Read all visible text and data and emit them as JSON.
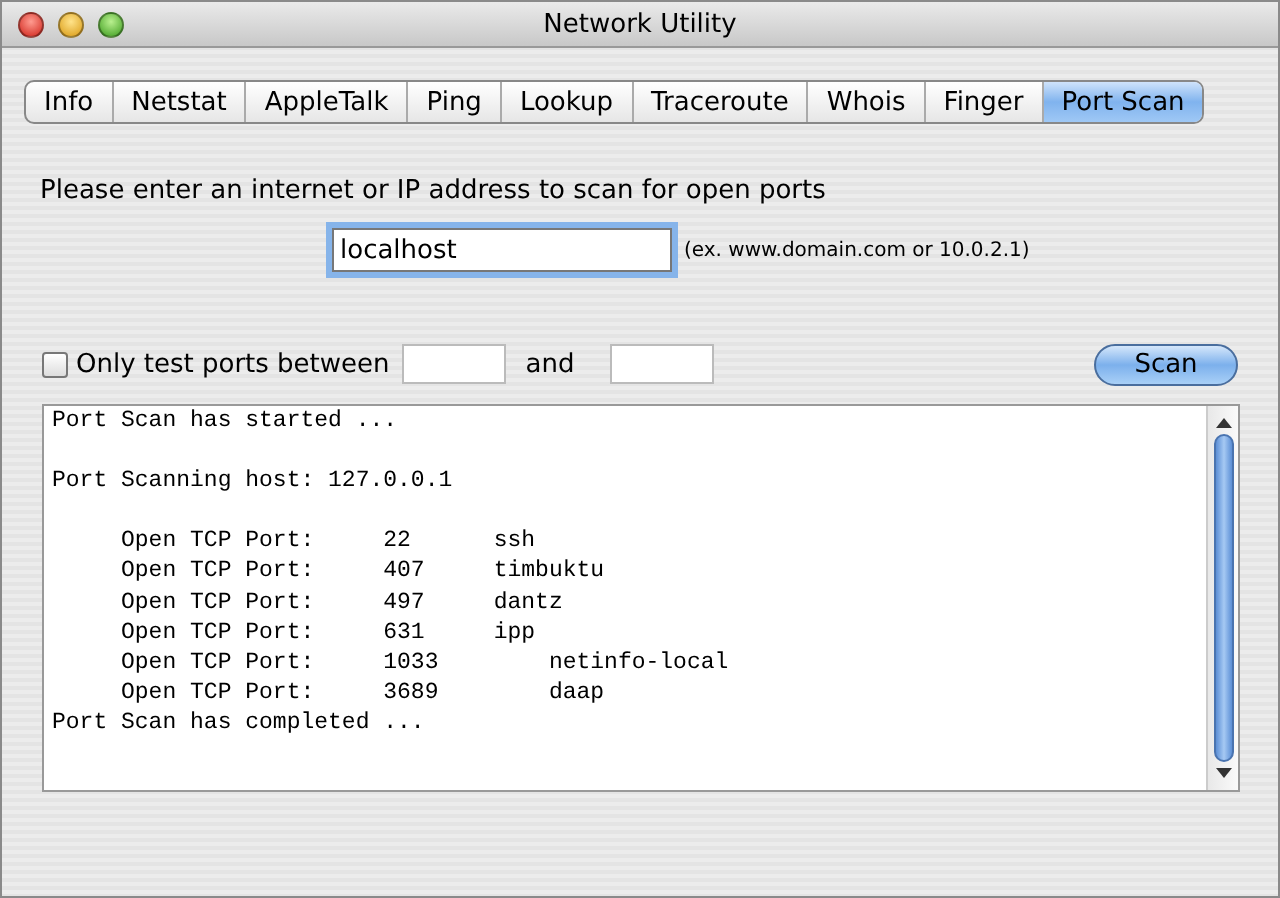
{
  "window": {
    "title": "Network Utility"
  },
  "tabs": [
    {
      "label": "Info",
      "selected": false
    },
    {
      "label": "Netstat",
      "selected": false
    },
    {
      "label": "AppleTalk",
      "selected": false
    },
    {
      "label": "Ping",
      "selected": false
    },
    {
      "label": "Lookup",
      "selected": false
    },
    {
      "label": "Traceroute",
      "selected": false
    },
    {
      "label": "Whois",
      "selected": false
    },
    {
      "label": "Finger",
      "selected": false
    },
    {
      "label": "Port Scan",
      "selected": true
    }
  ],
  "prompt": "Please enter an internet or IP address to scan for open ports",
  "address": {
    "value": "localhost",
    "hint": "(ex. www.domain.com or 10.0.2.1)"
  },
  "range": {
    "checked": false,
    "label": "Only test ports between",
    "and_label": "and"
  },
  "scan_button": "Scan",
  "output_paragraphs": [
    [
      "Port Scan has started ..."
    ],
    [
      "Port Scanning host: 127.0.0.1"
    ],
    [
      "     Open TCP Port:     22      ssh",
      "     Open TCP Port:     407     timbuktu",
      "     Open TCP Port:     497     dantz",
      "     Open TCP Port:     631     ipp",
      "     Open TCP Port:     1033        netinfo-local",
      "     Open TCP Port:     3689        daap",
      "Port Scan has completed ..."
    ]
  ]
}
